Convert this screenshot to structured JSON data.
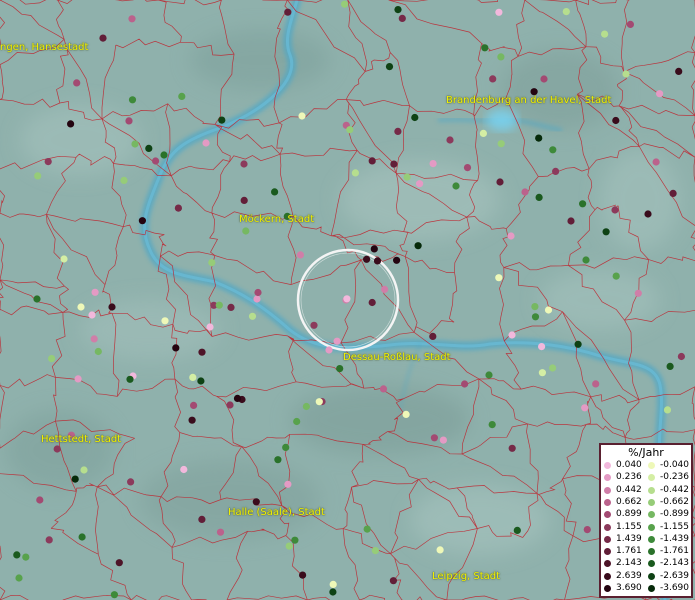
{
  "map": {
    "cities": [
      {
        "name": "ngen, Hansestadt"
      },
      {
        "name": "Brandenburg an der Havel, Stadt"
      },
      {
        "name": "Möckern, Stadt"
      },
      {
        "name": "Dessau-Roßlau, Stadt"
      },
      {
        "name": "Hettstedt, Stadt"
      },
      {
        "name": "Halle (Saale), Stadt"
      },
      {
        "name": "Leipzig, Stadt"
      }
    ],
    "colors": {
      "background": "#8fb1ac",
      "river": "#4fa7c6",
      "borders": "#c0202a",
      "city_label": "#f2f200",
      "focus_circle": "#ffffff"
    }
  },
  "legend": {
    "title": "%/Jahr",
    "positive": [
      {
        "label": "0.040",
        "color": "#f2b8dc"
      },
      {
        "label": "0.236",
        "color": "#e49ac4"
      },
      {
        "label": "0.442",
        "color": "#d07ea8"
      },
      {
        "label": "0.662",
        "color": "#bb628c"
      },
      {
        "label": "0.899",
        "color": "#a34a72"
      },
      {
        "label": "1.155",
        "color": "#8c3a5c"
      },
      {
        "label": "1.439",
        "color": "#762a48"
      },
      {
        "label": "1.761",
        "color": "#621e38"
      },
      {
        "label": "2.143",
        "color": "#4e1428"
      },
      {
        "label": "2.639",
        "color": "#3a0c1c"
      },
      {
        "label": "3.690",
        "color": "#240410"
      }
    ],
    "negative": [
      {
        "label": "-0.040",
        "color": "#eef8b8"
      },
      {
        "label": "-0.236",
        "color": "#d4eea4"
      },
      {
        "label": "-0.442",
        "color": "#b6de8e"
      },
      {
        "label": "-0.662",
        "color": "#96cc78"
      },
      {
        "label": "-0.899",
        "color": "#76b862"
      },
      {
        "label": "-1.155",
        "color": "#58a24c"
      },
      {
        "label": "-1.439",
        "color": "#3e8a3a"
      },
      {
        "label": "-1.761",
        "color": "#2a722a"
      },
      {
        "label": "-2.143",
        "color": "#1a5a1e"
      },
      {
        "label": "-2.639",
        "color": "#0e4214"
      },
      {
        "label": "-3.690",
        "color": "#062a0a"
      }
    ]
  }
}
